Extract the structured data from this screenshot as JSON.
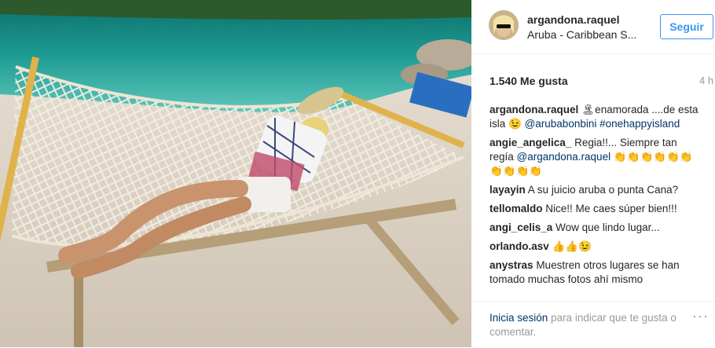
{
  "post": {
    "username": "argandona.raquel",
    "location": "Aruba - Caribbean S...",
    "follow_label": "Seguir",
    "likes": "1.540 Me gusta",
    "time": "4 h"
  },
  "comments": [
    {
      "user": "argandona.raquel",
      "parts": [
        {
          "t": "🏝enamorada ....de esta isla 😉 ",
          "link": false
        },
        {
          "t": "@arubabonbini",
          "link": true
        },
        {
          "t": " ",
          "link": false
        },
        {
          "t": "#onehappyisland",
          "link": true
        }
      ]
    },
    {
      "user": "angie_angelica_",
      "parts": [
        {
          "t": "Regia!!... Siempre tan regía ",
          "link": false
        },
        {
          "t": "@argandona.raquel",
          "link": true
        },
        {
          "t": " 👏👏👏👏👏👏👏👏👏👏",
          "link": false
        }
      ]
    },
    {
      "user": "layayin",
      "parts": [
        {
          "t": "A su juicio aruba o punta Cana?",
          "link": false
        }
      ]
    },
    {
      "user": "tellomaldo",
      "parts": [
        {
          "t": "Nice!! Me caes súper bien!!!",
          "link": false
        }
      ]
    },
    {
      "user": "angi_celis_a",
      "parts": [
        {
          "t": "Wow que lindo lugar...",
          "link": false
        }
      ]
    },
    {
      "user": "orlando.asv",
      "parts": [
        {
          "t": "👍👍😉",
          "link": false
        }
      ]
    },
    {
      "user": "anystras",
      "parts": [
        {
          "t": "Muestren otros lugares se han tomado muchas fotos ahí mismo",
          "link": false
        }
      ]
    }
  ],
  "footer": {
    "login_link": "Inicia sesión",
    "login_text": " para indicar que te gusta o comentar.",
    "more": "···"
  },
  "colors": {
    "link": "#003569",
    "accent": "#3897f0",
    "muted": "#999999"
  }
}
